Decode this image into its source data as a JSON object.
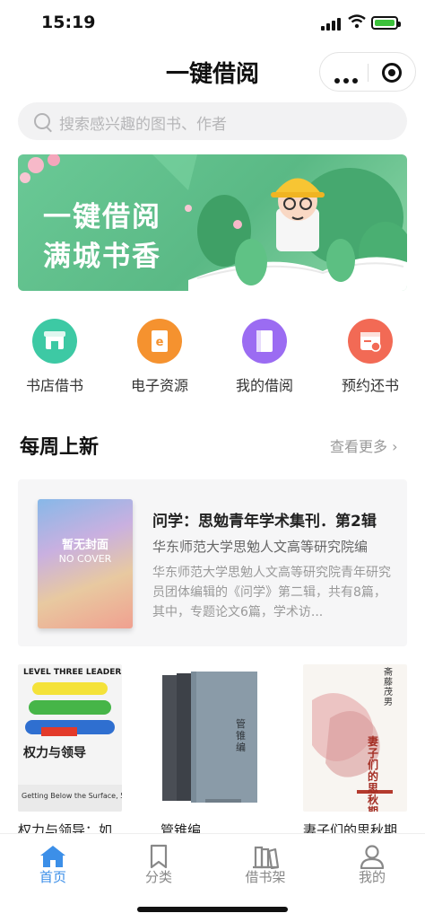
{
  "status_bar": {
    "time": "15:19"
  },
  "nav": {
    "title": "一键借阅"
  },
  "search": {
    "placeholder": "搜索感兴趣的图书、作者"
  },
  "banner": {
    "line1": "一键借阅",
    "line2": "满城书香"
  },
  "quick_actions": [
    {
      "label": "书店借书",
      "icon": "store-icon",
      "color": "#3dc9a4"
    },
    {
      "label": "电子资源",
      "icon": "ebook-icon",
      "color": "#f5922f"
    },
    {
      "label": "我的借阅",
      "icon": "book-icon",
      "color": "#9b6cf2"
    },
    {
      "label": "预约还书",
      "icon": "calendar-icon",
      "color": "#f26a55"
    }
  ],
  "weekly": {
    "title": "每周上新",
    "more": "查看更多",
    "featured": {
      "cover_text": "暂无封面",
      "cover_sub": "NO COVER",
      "title": "问学：思勉青年学术集刊．第2辑",
      "author": "华东师范大学思勉人文高等研究院编",
      "desc": "华东师范大学思勉人文高等研究院青年研究员团体编辑的《问学》第二辑，共有8篇，其中，专题论文6篇，学术访..."
    },
    "books": [
      {
        "title": "权力与领导：如",
        "cover_head": "LEVEL THREE LEADERSHIP",
        "cover_cn": "权力与领导",
        "cover_en": "Getting Below the Surface, 5e"
      },
      {
        "title": "管锥编",
        "cover_cn": "管锥编"
      },
      {
        "title": "妻子们的思秋期",
        "cover_cn": "妻子们的思秋期",
        "cover_author": "斋藤茂男"
      }
    ]
  },
  "tabs": [
    {
      "label": "首页",
      "icon": "home-icon",
      "active": true
    },
    {
      "label": "分类",
      "icon": "bookmark-icon",
      "active": false
    },
    {
      "label": "借书架",
      "icon": "bookshelf-icon",
      "active": false
    },
    {
      "label": "我的",
      "icon": "user-icon",
      "active": false
    }
  ],
  "colors": {
    "accent": "#3c8fe8",
    "banner": "#5ab985",
    "tab_inactive": "#888888"
  }
}
